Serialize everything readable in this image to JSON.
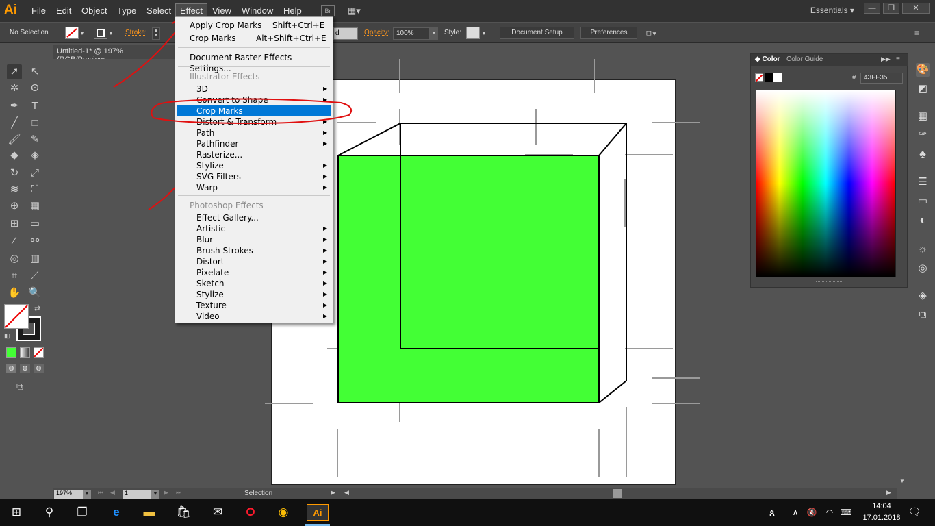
{
  "app": {
    "logo": "Ai"
  },
  "menubar": {
    "items": [
      "File",
      "Edit",
      "Object",
      "Type",
      "Select",
      "Effect",
      "View",
      "Window",
      "Help"
    ],
    "bridge_badge": "Br",
    "workspace": "Essentials",
    "workspace_chevron": "▾"
  },
  "window_controls": {
    "minimize": "—",
    "restore": "❐",
    "close": "✕"
  },
  "control_bar": {
    "selection": "No Selection",
    "stroke_label": "Stroke:",
    "opacity_label": "Opacity:",
    "opacity_value": "100%",
    "style_label": "Style:",
    "document_setup": "Document Setup",
    "preferences": "Preferences"
  },
  "document": {
    "tab_title": "Untitled-1* @ 197% (RGB/Preview"
  },
  "effect_menu": {
    "apply_crop_marks": {
      "label": "Apply Crop Marks",
      "shortcut": "Shift+Ctrl+E"
    },
    "crop_marks_top": {
      "label": "Crop Marks",
      "shortcut": "Alt+Shift+Ctrl+E"
    },
    "raster_settings": "Document Raster Effects Settings...",
    "illustrator_header": "Illustrator Effects",
    "illustrator_items": [
      {
        "label": "3D",
        "submenu": true
      },
      {
        "label": "Convert to Shape",
        "submenu": true
      },
      {
        "label": "Crop Marks",
        "submenu": false,
        "highlighted": true
      },
      {
        "label": "Distort & Transform",
        "submenu": true
      },
      {
        "label": "Path",
        "submenu": true
      },
      {
        "label": "Pathfinder",
        "submenu": true
      },
      {
        "label": "Rasterize...",
        "submenu": false
      },
      {
        "label": "Stylize",
        "submenu": true
      },
      {
        "label": "SVG Filters",
        "submenu": true
      },
      {
        "label": "Warp",
        "submenu": true
      }
    ],
    "photoshop_header": "Photoshop Effects",
    "photoshop_items": [
      {
        "label": "Effect Gallery...",
        "submenu": false
      },
      {
        "label": "Artistic",
        "submenu": true
      },
      {
        "label": "Blur",
        "submenu": true
      },
      {
        "label": "Brush Strokes",
        "submenu": true
      },
      {
        "label": "Distort",
        "submenu": true
      },
      {
        "label": "Pixelate",
        "submenu": true
      },
      {
        "label": "Sketch",
        "submenu": true
      },
      {
        "label": "Stylize",
        "submenu": true
      },
      {
        "label": "Texture",
        "submenu": true
      },
      {
        "label": "Video",
        "submenu": true
      }
    ],
    "submenu_arrow": "▶"
  },
  "color_panel": {
    "tab_color": "Color",
    "tab_guide": "Color Guide",
    "hash": "#",
    "hex_value": "43FF35",
    "fill_color": "#43ff35"
  },
  "status_bar": {
    "zoom": "197%",
    "artboard_number": "1",
    "mode": "Selection"
  },
  "taskbar": {
    "time": "14:04",
    "date": "17.01.2018",
    "ai_label": "Ai"
  },
  "colors": {
    "accent": "#0078d7",
    "annotation": "#e01010",
    "ai_orange": "#ff9a00"
  }
}
